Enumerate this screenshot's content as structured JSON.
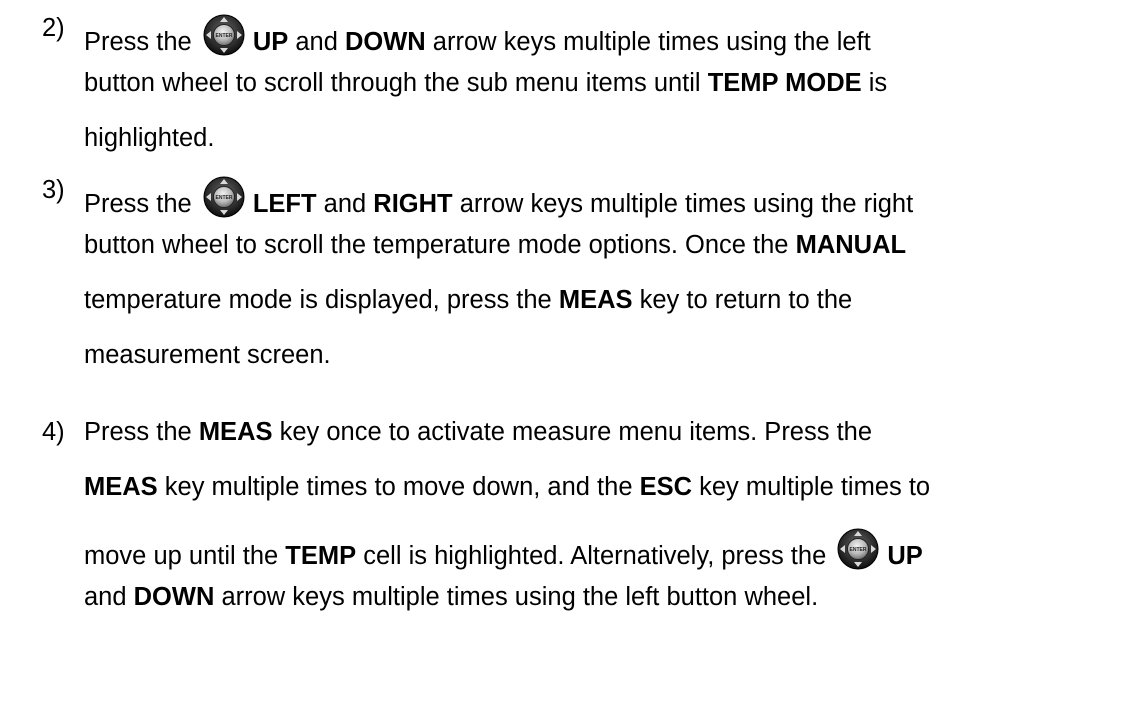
{
  "steps": [
    {
      "number": "2)",
      "lines": [
        {
          "t1": "Press the ",
          "b1": "UP",
          "t2": " and ",
          "b2": "DOWN",
          "t3": " arrow keys multiple times using the left"
        },
        {
          "t1": "button wheel to scroll through the sub menu items until ",
          "b1": "TEMP MODE",
          "t2": " is"
        },
        {
          "t1": "highlighted."
        }
      ]
    },
    {
      "number": "3)",
      "lines": [
        {
          "t1": "Press the ",
          "b1": "LEFT",
          "t2": " and ",
          "b2": "RIGHT",
          "t3": " arrow keys multiple times using the right"
        },
        {
          "t1": "button wheel to scroll the temperature mode options.  Once the ",
          "b1": "MANUAL"
        },
        {
          "t1": "temperature mode is displayed, press the ",
          "b1": "MEAS",
          "t2": " key to return to the"
        },
        {
          "t1": "measurement screen."
        }
      ]
    },
    {
      "number": "4)",
      "lines": [
        {
          "t1": "Press the ",
          "b1": "MEAS",
          "t2": " key once to activate measure menu items.  Press the"
        },
        {
          "b1": "MEAS",
          "t2": " key multiple times to move down, and the ",
          "b2": "ESC",
          "t3": " key multiple times to"
        },
        {
          "t1": "move up until the ",
          "b1": "TEMP",
          "t2": " cell is highlighted.  Alternatively, press the ",
          "b2": "UP"
        },
        {
          "t1": "and ",
          "b1": "DOWN",
          "t2": " arrow keys multiple times using the left button wheel."
        }
      ]
    }
  ],
  "icon": {
    "name": "button-wheel-icon",
    "center_label": "ENTER"
  },
  "colors": {
    "text": "#000000",
    "background": "#ffffff",
    "wheel_dark": "#1a1a1a",
    "wheel_light": "#8a8a8a"
  }
}
